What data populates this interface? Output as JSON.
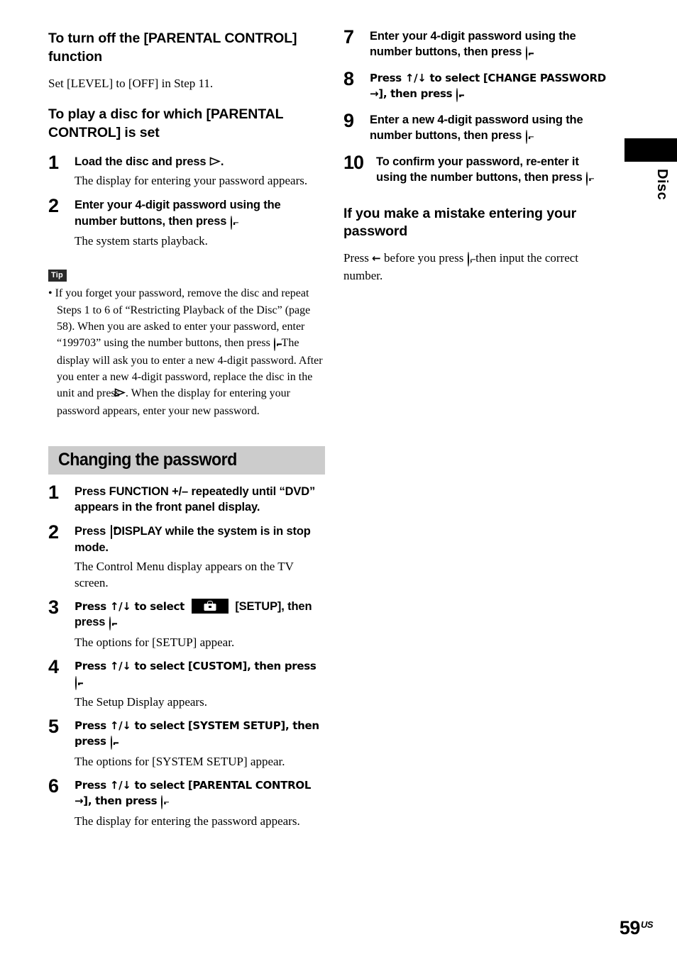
{
  "left_column": {
    "heading_turn_off": "To turn off the [PARENTAL CONTROL] function",
    "turn_off_body": "Set [LEVEL] to [OFF] in Step 11.",
    "heading_play_disc": "To play a disc for which [PARENTAL CONTROL] is set",
    "play_steps": [
      {
        "num": "1",
        "title_pre": "Load the disc and press ",
        "icon": "play-icon",
        "title_post": ".",
        "desc": "The display for entering your password appears."
      },
      {
        "num": "2",
        "title_pre": "Enter your 4-digit password using the number buttons, then press ",
        "icon": "enter-button-icon",
        "title_post": ".",
        "desc": "The system starts playback."
      }
    ],
    "tip": {
      "badge": "Tip",
      "text": "• If you forget your password, remove the disc and repeat Steps 1 to 6 of “Restricting Playback of the Disc” (page 58). When you are asked to enter your password, enter “199703” using the number buttons, then press ",
      "text_mid": ". The display will ask you to enter a new 4-digit password. After you enter a new 4-digit password, replace the disc in the unit and press ",
      "text_end": ". When the display for entering your password appears, enter your new password."
    },
    "section_title": "Changing the password",
    "change_steps": [
      {
        "num": "1",
        "title": "Press FUNCTION +/– repeatedly until “DVD” appears in the front panel display.",
        "desc": ""
      },
      {
        "num": "2",
        "title_pre": "Press ",
        "icon": "display-icon",
        "title_post": " DISPLAY while the system is in stop mode.",
        "desc": "The Control Menu display appears on the TV screen."
      },
      {
        "num": "3",
        "title_pre": "Press ↑/↓ to select ",
        "icon": "setup-icon",
        "title_mid": " [SETUP], then press ",
        "icon2": "enter-button-icon",
        "title_post": ".",
        "desc": "The options for [SETUP] appear."
      },
      {
        "num": "4",
        "title_pre": "Press ↑/↓ to select [CUSTOM], then press ",
        "icon": "enter-button-icon",
        "title_post": ".",
        "desc": "The Setup Display appears."
      },
      {
        "num": "5",
        "title_pre": "Press ↑/↓ to select [SYSTEM SETUP], then press ",
        "icon": "enter-button-icon",
        "title_post": ".",
        "desc": "The options for [SYSTEM SETUP] appear."
      },
      {
        "num": "6",
        "title_pre": "Press ↑/↓ to select [PARENTAL CONTROL →], then press ",
        "icon": "enter-button-icon",
        "title_post": ".",
        "desc": "The display for entering the password appears."
      }
    ]
  },
  "right_column": {
    "steps": [
      {
        "num": "7",
        "title_pre": "Enter your 4-digit password using the number buttons, then press ",
        "icon": "enter-button-icon",
        "title_post": "."
      },
      {
        "num": "8",
        "title_pre": "Press ↑/↓ to select [CHANGE PASSWORD →], then press ",
        "icon": "enter-button-icon",
        "title_post": "."
      },
      {
        "num": "9",
        "title_pre": "Enter a new 4-digit password using the number buttons, then press ",
        "icon": "enter-button-icon",
        "title_post": "."
      },
      {
        "num": "10",
        "title_pre": "To confirm your password, re-enter it using the number buttons, then press ",
        "icon": "enter-button-icon",
        "title_post": "."
      }
    ],
    "mistake_heading": "If you make a mistake entering your password",
    "mistake_pre": "Press ",
    "mistake_arrow": "←",
    "mistake_mid": " before you press ",
    "mistake_end": ", then input the correct number."
  },
  "side_tab": {
    "label": "Disc"
  },
  "footer": {
    "page_number": "59",
    "region": "US"
  }
}
